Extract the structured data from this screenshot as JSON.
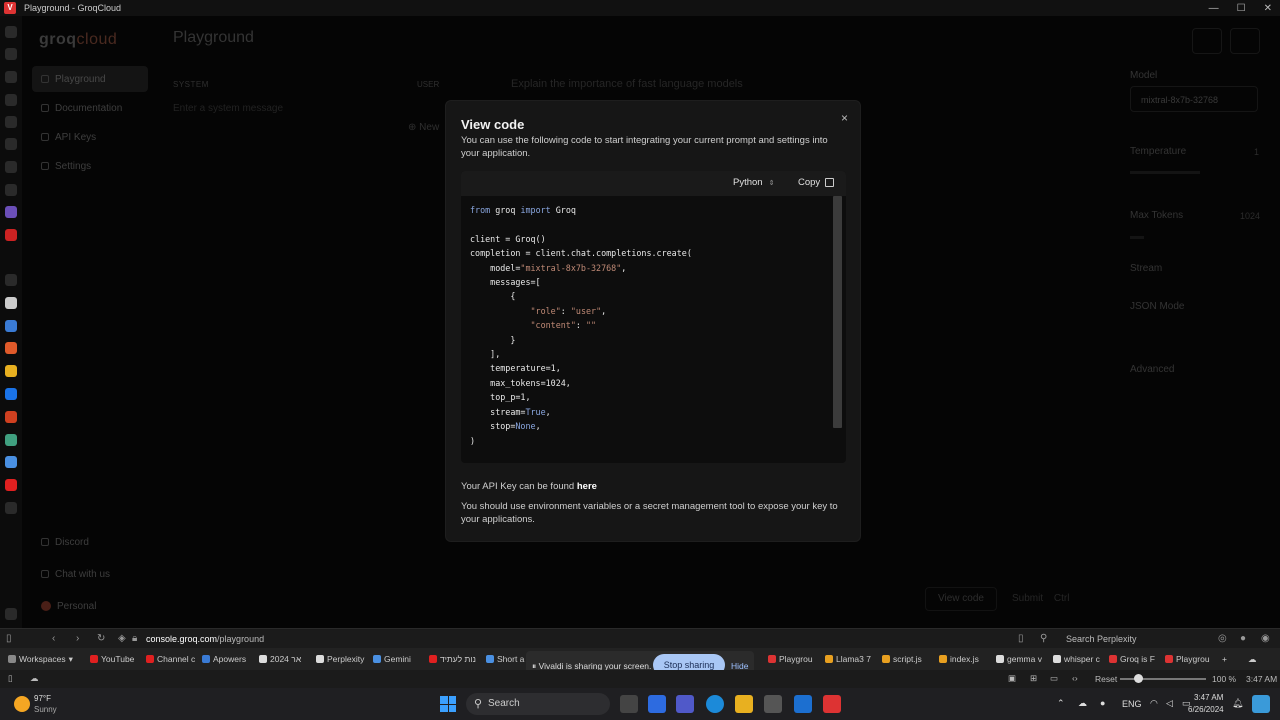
{
  "window": {
    "title": "Playground - GroqCloud",
    "minimize": "—",
    "maximize": "☐",
    "close": "✕"
  },
  "app": {
    "logo_main": "groq",
    "logo_sub": "cloud",
    "nav": [
      "Playground",
      "Documentation",
      "API Keys",
      "Settings"
    ],
    "nav_bottom": [
      "Discord",
      "Chat with us",
      "Personal"
    ],
    "page_title": "Playground",
    "system_label": "SYSTEM",
    "system_placeholder": "Enter a system message",
    "user_label": "USER",
    "user_placeholder": "Explain the importance of fast language models",
    "new_message": "New",
    "right": {
      "model_label": "Model",
      "model_value": "mixtral-8x7b-32768",
      "temperature_label": "Temperature",
      "temperature_value": "1",
      "max_tokens_label": "Max Tokens",
      "max_tokens_value": "1024",
      "stream_label": "Stream",
      "json_label": "JSON Mode",
      "advanced_label": "Advanced"
    },
    "view_code_btn": "View code",
    "submit_btn": "Submit",
    "submit_hint": "Ctrl"
  },
  "modal": {
    "title": "View code",
    "description": "You can use the following code to start integrating your current prompt and settings into your application.",
    "language": "Python",
    "copy": "Copy",
    "close": "×",
    "api_prefix": "Your API Key can be found",
    "api_link": "here",
    "api_desc": "You should use environment variables or a secret management tool to expose your key to your applications."
  },
  "addressbar": {
    "url_host": "console.groq.com",
    "url_path": "/playground",
    "search_placeholder": "Search Perplexity"
  },
  "tabs": [
    {
      "label": "Workspaces",
      "color": "#888"
    },
    {
      "label": "YouTube",
      "color": "#e02020"
    },
    {
      "label": "Channel c",
      "color": "#e02020"
    },
    {
      "label": "Apowers",
      "color": "#3a7bd5"
    },
    {
      "label": "2024 אר",
      "color": "#ddd"
    },
    {
      "label": "Perplexity",
      "color": "#ddd"
    },
    {
      "label": "Gemini",
      "color": "#4a90e2"
    },
    {
      "label": "נות לעתיד",
      "color": "#e02020"
    },
    {
      "label": "Short a",
      "color": "#4a90e2"
    },
    {
      "label": "Playgrou",
      "color": "#d33"
    },
    {
      "label": "Llama3 7",
      "color": "#e8a020"
    },
    {
      "label": "script.js",
      "color": "#e8a020"
    },
    {
      "label": "index.js",
      "color": "#e8a020"
    },
    {
      "label": "gemma v",
      "color": "#ddd"
    },
    {
      "label": "whisper c",
      "color": "#ddd"
    },
    {
      "label": "Groq is F",
      "color": "#d33"
    },
    {
      "label": "Playgrou",
      "color": "#d33"
    }
  ],
  "sharing": {
    "text": "Vivaldi is sharing your screen.",
    "stop": "Stop sharing",
    "hide": "Hide"
  },
  "statusbar": {
    "reset": "Reset",
    "zoom": "100 %",
    "time": "3:47 AM"
  },
  "taskbar": {
    "temp": "97°F",
    "weather": "Sunny",
    "search": "Search",
    "lang": "ENG",
    "time": "3:47 AM",
    "date": "6/26/2024"
  }
}
